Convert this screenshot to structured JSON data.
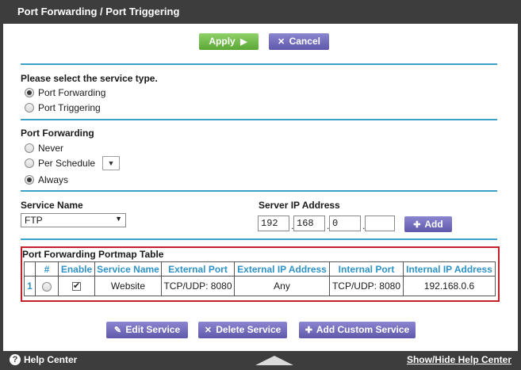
{
  "window": {
    "title": "Port Forwarding / Port Triggering"
  },
  "actions": {
    "apply": "Apply",
    "cancel": "Cancel"
  },
  "service_type": {
    "heading": "Please select the service type.",
    "options": [
      "Port Forwarding",
      "Port Triggering"
    ],
    "selected": "Port Forwarding"
  },
  "port_forwarding": {
    "heading": "Port Forwarding",
    "options": [
      "Never",
      "Per Schedule",
      "Always"
    ],
    "selected": "Always"
  },
  "service": {
    "label": "Service Name",
    "value": "FTP"
  },
  "server_ip": {
    "label": "Server IP Address",
    "octets": [
      "192",
      "168",
      "0",
      ""
    ],
    "add_label": "Add"
  },
  "portmap": {
    "title": "Port Forwarding Portmap Table",
    "columns": [
      "#",
      "Enable",
      "Service Name",
      "External Port",
      "External IP Address",
      "Internal Port",
      "Internal IP Address"
    ],
    "rows": [
      {
        "index": "1",
        "enabled": true,
        "service": "Website",
        "external_port": "TCP/UDP: 8080",
        "external_ip": "Any",
        "internal_port": "TCP/UDP: 8080",
        "internal_ip": "192.168.0.6"
      }
    ]
  },
  "row_actions": {
    "edit": "Edit Service",
    "delete": "Delete Service",
    "add_custom": "Add Custom Service"
  },
  "footer": {
    "help": "Help Center",
    "toggle": "Show/Hide Help Center"
  },
  "colors": {
    "accent_blue": "#2e93c6",
    "rule_blue": "#3ca1c7",
    "highlight_red": "#c41f2b",
    "button_green": "#6ab943",
    "button_purple": "#6e68b8",
    "chrome": "#3d3d3d"
  }
}
